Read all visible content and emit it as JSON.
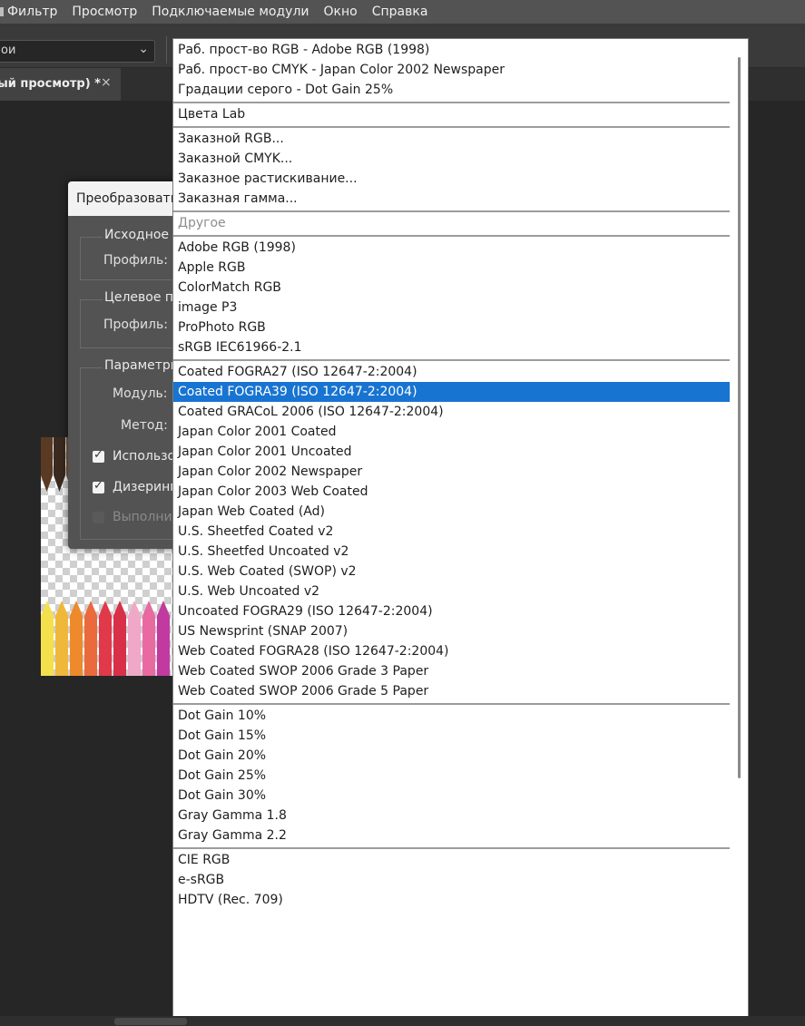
{
  "menubar": {
    "items": [
      "Фильтр",
      "Просмотр",
      "Подключаемые модули",
      "Окно",
      "Справка"
    ]
  },
  "optionsbar": {
    "preset_value": "ои"
  },
  "tab": {
    "label": "ый просмотр) *",
    "close": "×"
  },
  "dialog": {
    "title": "Преобразовать",
    "source_group": "Исходное п",
    "source_profile_label": "Профиль:",
    "target_group": "Целевое пр",
    "target_profile_label": "Профиль:",
    "params_group": "Параметры",
    "module_label": "Модуль:",
    "method_label": "Метод:",
    "checkbox_use": "Использо",
    "checkbox_dither": "Дизеринг",
    "checkbox_flatten": "Выполнит"
  },
  "dropdown": {
    "sections": [
      {
        "items": [
          {
            "label": "Раб. прост-во RGB - Adobe RGB (1998)"
          },
          {
            "label": "Раб. прост-во CMYK - Japan Color 2002 Newspaper"
          },
          {
            "label": "Градации серого - Dot Gain 25%"
          }
        ]
      },
      {
        "items": [
          {
            "label": "Цвета Lab"
          }
        ]
      },
      {
        "items": [
          {
            "label": "Заказной RGB..."
          },
          {
            "label": "Заказной CMYK..."
          },
          {
            "label": "Заказное растискивание..."
          },
          {
            "label": "Заказная гамма..."
          }
        ]
      },
      {
        "items": [
          {
            "label": "Другое",
            "disabled": true
          }
        ]
      },
      {
        "items": [
          {
            "label": "Adobe RGB (1998)"
          },
          {
            "label": "Apple RGB"
          },
          {
            "label": "ColorMatch RGB"
          },
          {
            "label": "image P3"
          },
          {
            "label": "ProPhoto RGB"
          },
          {
            "label": "sRGB IEC61966-2.1"
          }
        ]
      },
      {
        "items": [
          {
            "label": "Coated FOGRA27 (ISO 12647-2:2004)"
          },
          {
            "label": "Coated FOGRA39 (ISO 12647-2:2004)",
            "selected": true
          },
          {
            "label": "Coated GRACoL 2006 (ISO 12647-2:2004)"
          },
          {
            "label": "Japan Color 2001 Coated"
          },
          {
            "label": "Japan Color 2001 Uncoated"
          },
          {
            "label": "Japan Color 2002 Newspaper"
          },
          {
            "label": "Japan Color 2003 Web Coated"
          },
          {
            "label": "Japan Web Coated (Ad)"
          },
          {
            "label": "U.S. Sheetfed Coated v2"
          },
          {
            "label": "U.S. Sheetfed Uncoated v2"
          },
          {
            "label": "U.S. Web Coated (SWOP) v2"
          },
          {
            "label": "U.S. Web Uncoated v2"
          },
          {
            "label": "Uncoated FOGRA29 (ISO 12647-2:2004)"
          },
          {
            "label": "US Newsprint (SNAP 2007)"
          },
          {
            "label": "Web Coated FOGRA28 (ISO 12647-2:2004)"
          },
          {
            "label": "Web Coated SWOP 2006 Grade 3 Paper"
          },
          {
            "label": "Web Coated SWOP 2006 Grade 5 Paper"
          }
        ]
      },
      {
        "items": [
          {
            "label": "Dot Gain 10%"
          },
          {
            "label": "Dot Gain 15%"
          },
          {
            "label": "Dot Gain 20%"
          },
          {
            "label": "Dot Gain 25%"
          },
          {
            "label": "Dot Gain 30%"
          },
          {
            "label": "Gray Gamma 1.8"
          },
          {
            "label": "Gray Gamma 2.2"
          }
        ]
      },
      {
        "items": [
          {
            "label": "CIE RGB"
          },
          {
            "label": "e-sRGB"
          },
          {
            "label": "HDTV (Rec. 709)"
          }
        ]
      }
    ]
  },
  "colors": {
    "selected_bg": "#1874d1",
    "menubar_bg": "#535353",
    "workspace_bg": "#262626"
  },
  "pencils": [
    "#5a3a22",
    "#3a2a1f",
    "#7a5a3c",
    "#c8a078",
    "#222222",
    "#d9c9b6",
    "#8a6a4a",
    "#b08050",
    "#e0d4c4"
  ],
  "pencils_bottom": [
    "#f4e04d",
    "#f0b83a",
    "#ee8a2c",
    "#ea6a3c",
    "#e0394a",
    "#d9304a",
    "#f0a8c8",
    "#e86aa0",
    "#c03aa0"
  ]
}
